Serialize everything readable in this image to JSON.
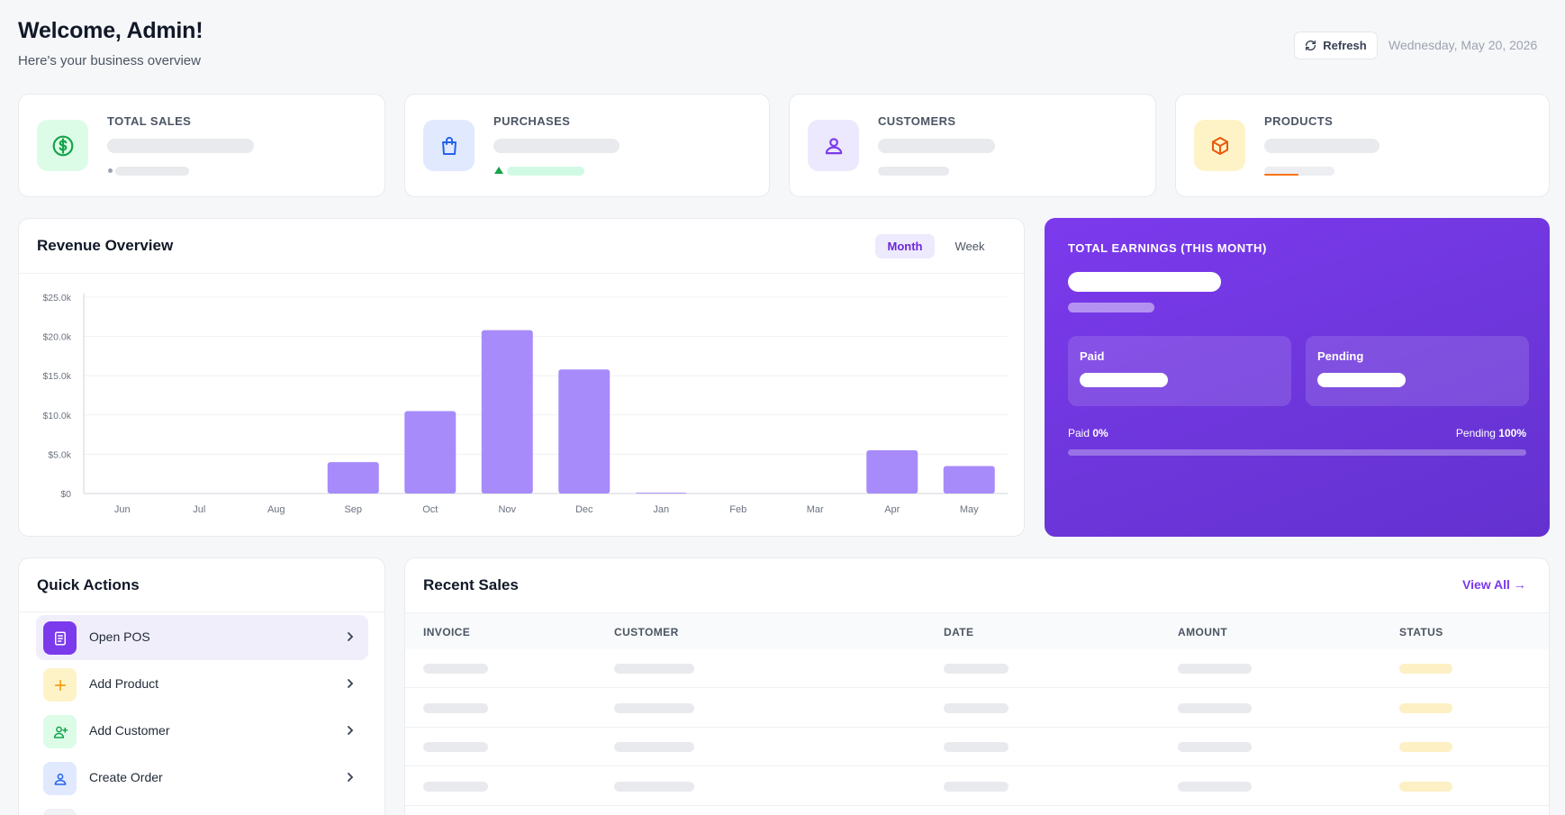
{
  "header": {
    "title": "Welcome, Admin!",
    "subtitle": "Here's your business overview",
    "refresh_label": "Refresh",
    "date": "Wednesday, May 20, 2026"
  },
  "stats": [
    {
      "label": "TOTAL SALES",
      "icon": "dollar-icon",
      "color": "#16a34a",
      "bg": "#dcfce7"
    },
    {
      "label": "PURCHASES",
      "icon": "shopping-bag-icon",
      "color": "#2563eb",
      "bg": "#e0e9fe"
    },
    {
      "label": "CUSTOMERS",
      "icon": "user-icon",
      "color": "#7c3aed",
      "bg": "#ece8fd"
    },
    {
      "label": "PRODUCTS",
      "icon": "box-icon",
      "color": "#ea580c",
      "bg": "#fef3c7"
    }
  ],
  "revenue": {
    "title": "Revenue Overview",
    "toggle_month": "Month",
    "toggle_week": "Week"
  },
  "chart_data": {
    "type": "bar",
    "categories": [
      "Jun",
      "Jul",
      "Aug",
      "Sep",
      "Oct",
      "Nov",
      "Dec",
      "Jan",
      "Feb",
      "Mar",
      "Apr",
      "May"
    ],
    "values": [
      0,
      0,
      0,
      4000,
      10500,
      20800,
      15800,
      100,
      0,
      0,
      5500,
      3500
    ],
    "ytick_labels": [
      "$0",
      "$5.0k",
      "$10.0k",
      "$15.0k",
      "$20.0k",
      "$25.0k"
    ],
    "ylim": [
      0,
      25000
    ],
    "bar_color": "#a78bfa",
    "grid": true,
    "xlabel": "",
    "ylabel": ""
  },
  "earnings": {
    "title": "TOTAL EARNINGS (THIS MONTH)",
    "paid_label": "Paid",
    "pending_label": "Pending",
    "paid_pct_label": "Paid",
    "paid_pct": "0%",
    "pending_pct_label": "Pending",
    "pending_pct": "100%",
    "paid_fraction": 0
  },
  "quick_actions": {
    "title": "Quick Actions",
    "items": [
      {
        "label": "Open POS",
        "icon": "pos-icon",
        "color": "#ffffff",
        "bg": "#7c3aed"
      },
      {
        "label": "Add Product",
        "icon": "plus-icon",
        "color": "#f59e0b",
        "bg": "#fef3c7"
      },
      {
        "label": "Add Customer",
        "icon": "user-add-icon",
        "color": "#16a34a",
        "bg": "#dcfce7"
      },
      {
        "label": "Create Order",
        "icon": "order-icon",
        "color": "#2563eb",
        "bg": "#e0e9fe"
      }
    ]
  },
  "recent_sales": {
    "title": "Recent Sales",
    "view_all": "View All →",
    "columns": [
      "INVOICE",
      "CUSTOMER",
      "DATE",
      "AMOUNT",
      "STATUS"
    ]
  }
}
